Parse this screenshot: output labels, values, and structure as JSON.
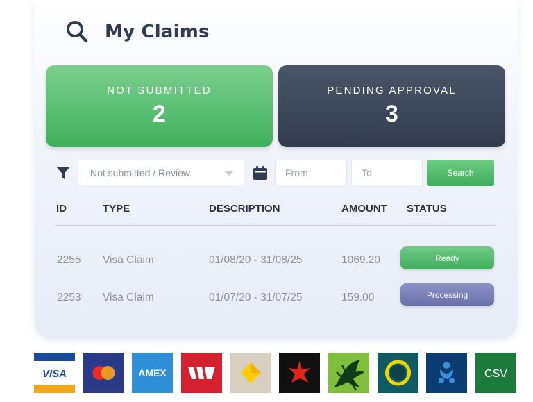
{
  "header": {
    "title": "My Claims",
    "search_icon": "search-icon"
  },
  "summary": {
    "not_submitted": {
      "label": "NOT SUBMITTED",
      "count": "2",
      "color": "#4cb865"
    },
    "pending_approval": {
      "label": "PENDING APPROVAL",
      "count": "3",
      "color": "#3a4558"
    }
  },
  "filters": {
    "status_select_value": "Not submitted / Review",
    "from_placeholder": "From",
    "to_placeholder": "To",
    "search_label": "Search",
    "filter_icon": "filter-icon",
    "calendar_icon": "calendar-icon"
  },
  "table": {
    "columns": [
      "ID",
      "TYPE",
      "DESCRIPTION",
      "AMOUNT",
      "STATUS"
    ],
    "rows": [
      {
        "id": "2255",
        "type": "Visa Claim",
        "description": "01/08/20 - 31/08/25",
        "amount": "1069.20",
        "status": "Ready",
        "status_color": "#4cb865"
      },
      {
        "id": "2253",
        "type": "Visa Claim",
        "description": "01/07/20 - 31/07/25",
        "amount": "159.00",
        "status": "Processing",
        "status_color": "#777fb8"
      }
    ]
  },
  "payment_methods": [
    {
      "name": "visa",
      "label": "VISA"
    },
    {
      "name": "mastercard"
    },
    {
      "name": "amex",
      "label": "AMEX"
    },
    {
      "name": "westpac"
    },
    {
      "name": "commonwealth-bank"
    },
    {
      "name": "nab"
    },
    {
      "name": "st-george"
    },
    {
      "name": "bank-ring"
    },
    {
      "name": "anz"
    },
    {
      "name": "csv",
      "label": "CSV"
    }
  ]
}
